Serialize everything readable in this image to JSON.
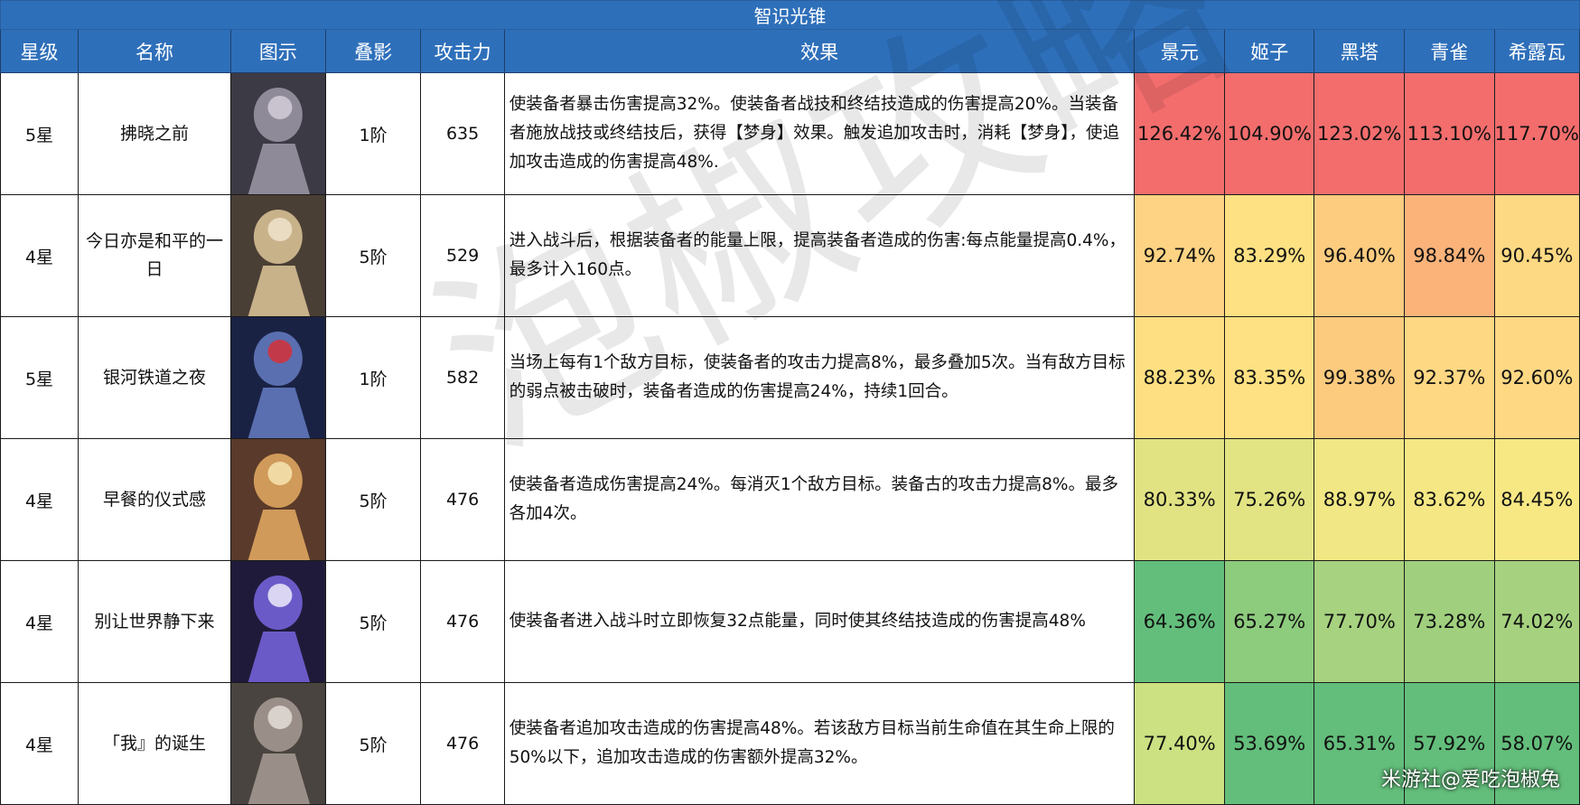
{
  "title": "智识光锥",
  "headers": [
    "星级",
    "名称",
    "图示",
    "叠影",
    "攻击力",
    "效果",
    "景元",
    "姬子",
    "黑塔",
    "青雀",
    "希露瓦"
  ],
  "rows": [
    {
      "star": "5星",
      "name": "拂晓之前",
      "image": "character-art",
      "superimpose": "1阶",
      "atk": "635",
      "effect": "使装备者暴击伤害提高32%。使装备者战技和终结技造成的伤害提高20%。当装备者施放战技或终结技后，获得【梦身】效果。触发追加攻击时，消耗【梦身】，使追加攻击造成的伤害提高48%.",
      "values": [
        "126.42%",
        "104.90%",
        "123.02%",
        "113.10%",
        "117.70%"
      ],
      "colors": [
        "#f36d6d",
        "#f36d6d",
        "#f36d6d",
        "#f36d6d",
        "#f36d6d"
      ]
    },
    {
      "star": "4星",
      "name": "今日亦是和平的一日",
      "image": "character-art",
      "superimpose": "5阶",
      "atk": "529",
      "effect": "进入战斗后，根据装备者的能量上限，提高装备者造成的伤害:每点能量提高0.4%，最多计入160点。",
      "values": [
        "92.74%",
        "83.29%",
        "96.40%",
        "98.84%",
        "90.45%"
      ],
      "colors": [
        "#fed383",
        "#fee182",
        "#fdcc7f",
        "#fbb37a",
        "#fed983"
      ]
    },
    {
      "star": "5星",
      "name": "银河铁道之夜",
      "image": "character-art",
      "superimpose": "1阶",
      "atk": "582",
      "effect": "当场上每有1个敌方目标，使装备者的攻击力提高8%，最多叠加5次。当有敌方目标的弱点被击破时，装备者造成的伤害提高24%，持续1回合。",
      "values": [
        "88.23%",
        "83.35%",
        "99.38%",
        "92.37%",
        "92.60%"
      ],
      "colors": [
        "#fee082",
        "#fee182",
        "#fccb7e",
        "#fed883",
        "#fed883"
      ]
    },
    {
      "star": "4星",
      "name": "早餐的仪式感",
      "image": "character-art",
      "superimpose": "5阶",
      "atk": "476",
      "effect": "使装备者造成伤害提高24%。每消灭1个敌方目标。装备古的攻击力提高8%。最多各加4次。",
      "values": [
        "80.33%",
        "75.26%",
        "88.97%",
        "83.62%",
        "84.45%"
      ],
      "colors": [
        "#e1e383",
        "#e2e483",
        "#f1e784",
        "#f5e884",
        "#f7e884"
      ]
    },
    {
      "star": "4星",
      "name": "别让世界静下来",
      "image": "character-art",
      "superimpose": "5阶",
      "atk": "476",
      "effect": "使装备者进入战斗时立即恢复32点能量，同时使其终结技造成的伤害提高48%",
      "values": [
        "64.36%",
        "65.27%",
        "77.70%",
        "73.28%",
        "74.02%"
      ],
      "colors": [
        "#63be7b",
        "#8dcb7d",
        "#a7d27f",
        "#a0d07e",
        "#a6d27f"
      ]
    },
    {
      "star": "4星",
      "name": "「我』的诞生",
      "image": "character-art",
      "superimpose": "5阶",
      "atk": "476",
      "effect": "使装备者追加攻击造成的伤害提高48%。若该敌方目标当前生命值在其生命上限的50%以下，追加攻击造成的伤害额外提高32%。",
      "values": [
        "77.40%",
        "53.69%",
        "65.31%",
        "57.92%",
        "58.07%"
      ],
      "colors": [
        "#cce182",
        "#63be7b",
        "#63be7b",
        "#63be7b",
        "#63be7b"
      ]
    }
  ],
  "watermark": "泡椒攻略",
  "credit": "米游社@爱吃泡椒兔"
}
